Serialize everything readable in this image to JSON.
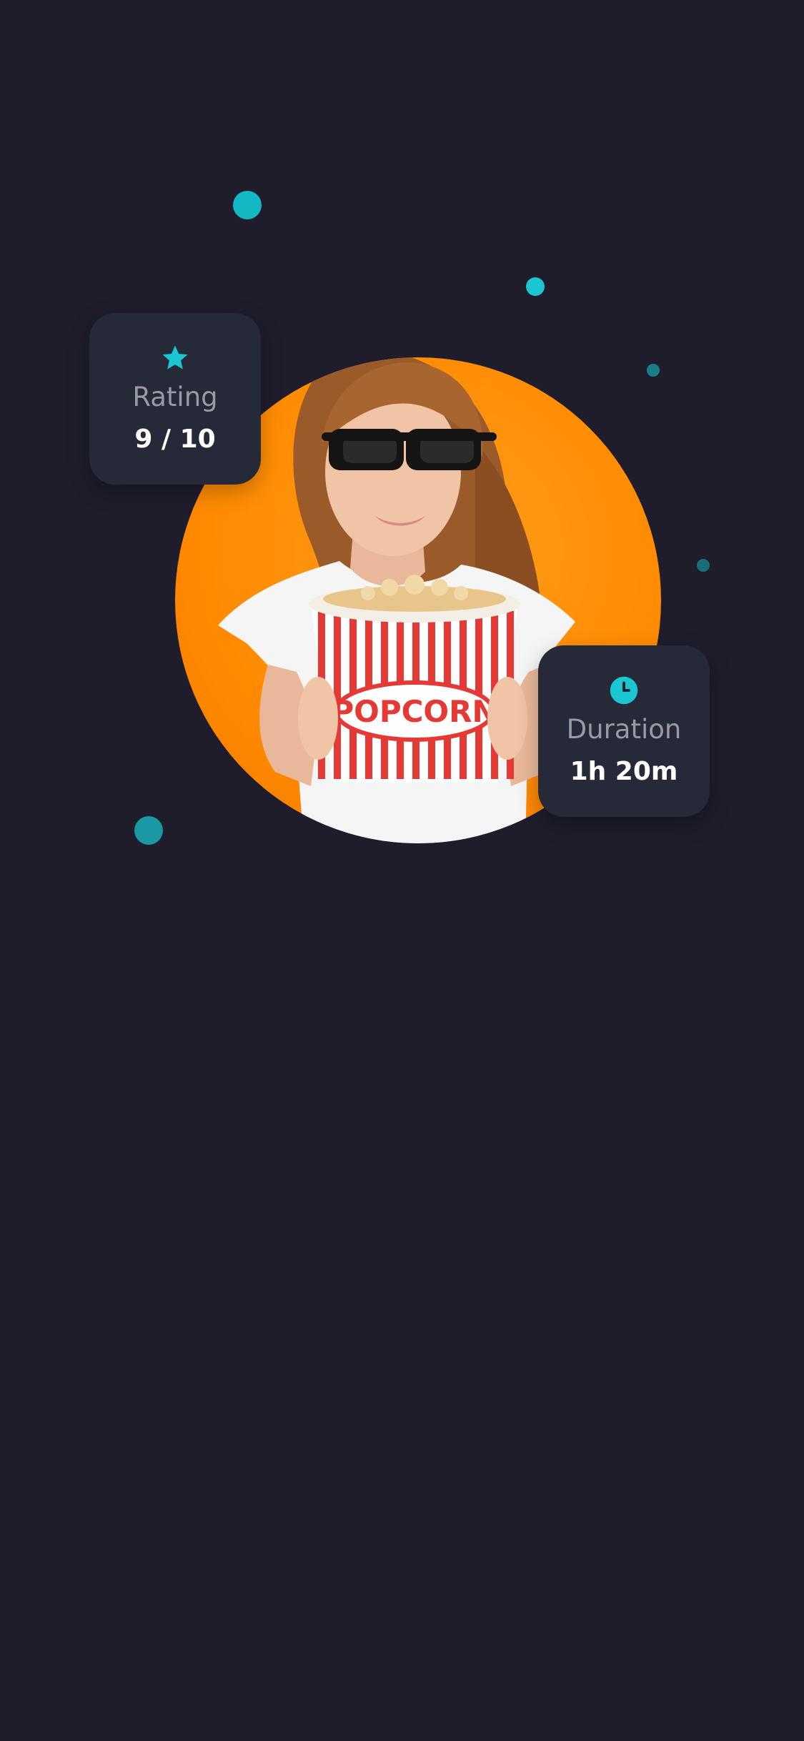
{
  "colors": {
    "background": "#1f1c2c",
    "accent": "#1ac6d1",
    "hero_circle": "#ff8a00",
    "card_background": "#262938"
  },
  "hero": {
    "image_alt": "woman with 3D glasses holding popcorn bucket",
    "popcorn_text": "POPCORN"
  },
  "rating_card": {
    "icon": "star-icon",
    "label": "Rating",
    "value": "9 / 10"
  },
  "duration_card": {
    "icon": "clock-icon",
    "label": "Duration",
    "value": "1h 20m"
  }
}
